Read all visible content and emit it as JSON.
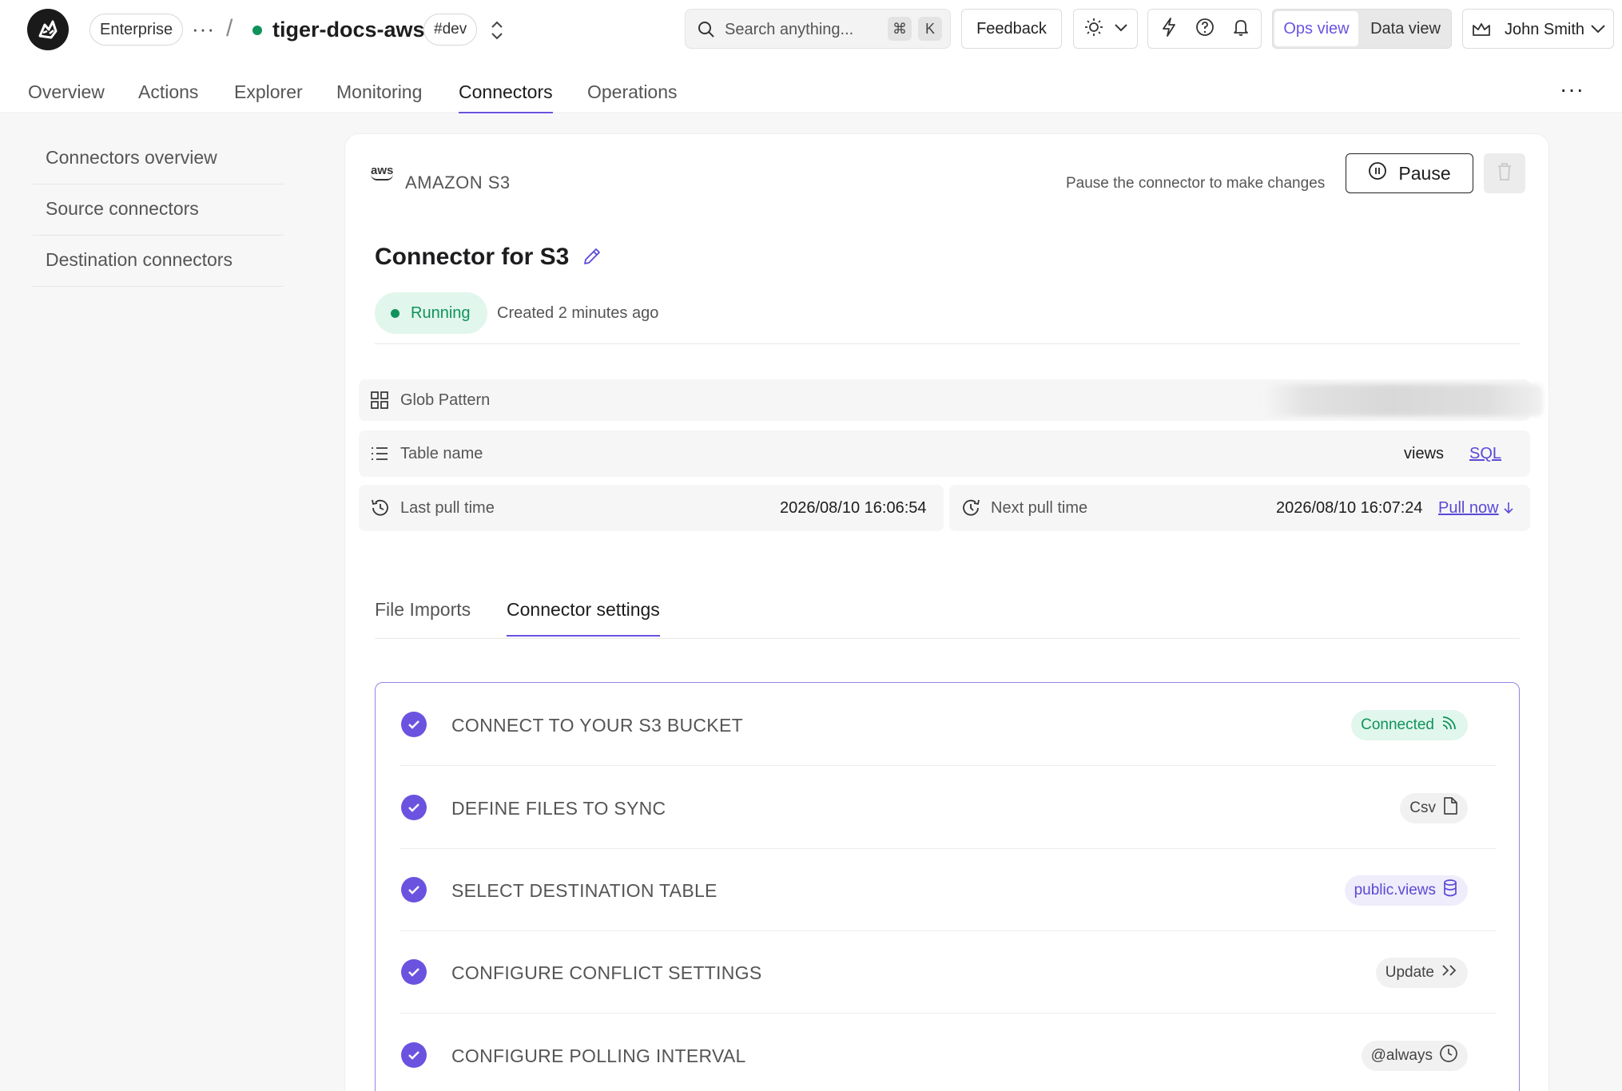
{
  "header": {
    "plan": "Enterprise",
    "service_name": "tiger-docs-aws",
    "environment": "#dev",
    "search": {
      "placeholder": "Search anything...",
      "shortcut_cmd": "⌘",
      "shortcut_key": "K"
    },
    "feedback_label": "Feedback",
    "views": {
      "ops": "Ops view",
      "data": "Data view",
      "active": "ops"
    },
    "user_name": "John Smith",
    "status_color": "#10935b",
    "accent_color": "#6b53e0"
  },
  "nav": {
    "tabs": [
      "Overview",
      "Actions",
      "Explorer",
      "Monitoring",
      "Connectors",
      "Operations"
    ],
    "active": "Connectors"
  },
  "sidebar": {
    "items": [
      "Connectors overview",
      "Source connectors",
      "Destination connectors"
    ]
  },
  "connector": {
    "source_logo_text": "aws",
    "source_type": "AMAZON S3",
    "pause_note": "Pause the connector to make changes",
    "pause_label": "Pause",
    "title": "Connector for S3",
    "status": "Running",
    "created": "Created 2 minutes ago",
    "details": {
      "glob_pattern_label": "Glob Pattern",
      "table_name_label": "Table name",
      "table_name_value": "views",
      "table_name_link": "SQL",
      "last_pull_label": "Last pull time",
      "last_pull_value": "2026/08/10 16:06:54",
      "next_pull_label": "Next pull time",
      "next_pull_value": "2026/08/10 16:07:24",
      "pull_now_label": "Pull now"
    }
  },
  "subtabs": {
    "items": [
      "File Imports",
      "Connector settings"
    ],
    "active": "Connector settings"
  },
  "steps": [
    {
      "label": "CONNECT TO YOUR S3 BUCKET",
      "chip": "Connected",
      "chip_icon": "signal-icon",
      "chip_style": "green"
    },
    {
      "label": "DEFINE FILES TO SYNC",
      "chip": "Csv",
      "chip_icon": "file-icon",
      "chip_style": "gray"
    },
    {
      "label": "SELECT DESTINATION TABLE",
      "chip": "public.views",
      "chip_icon": "database-icon",
      "chip_style": "purple"
    },
    {
      "label": "CONFIGURE CONFLICT SETTINGS",
      "chip": "Update",
      "chip_icon": "double-chevron-right-icon",
      "chip_style": "gray"
    },
    {
      "label": "CONFIGURE POLLING INTERVAL",
      "chip": "@always",
      "chip_icon": "clock-icon",
      "chip_style": "gray"
    }
  ]
}
